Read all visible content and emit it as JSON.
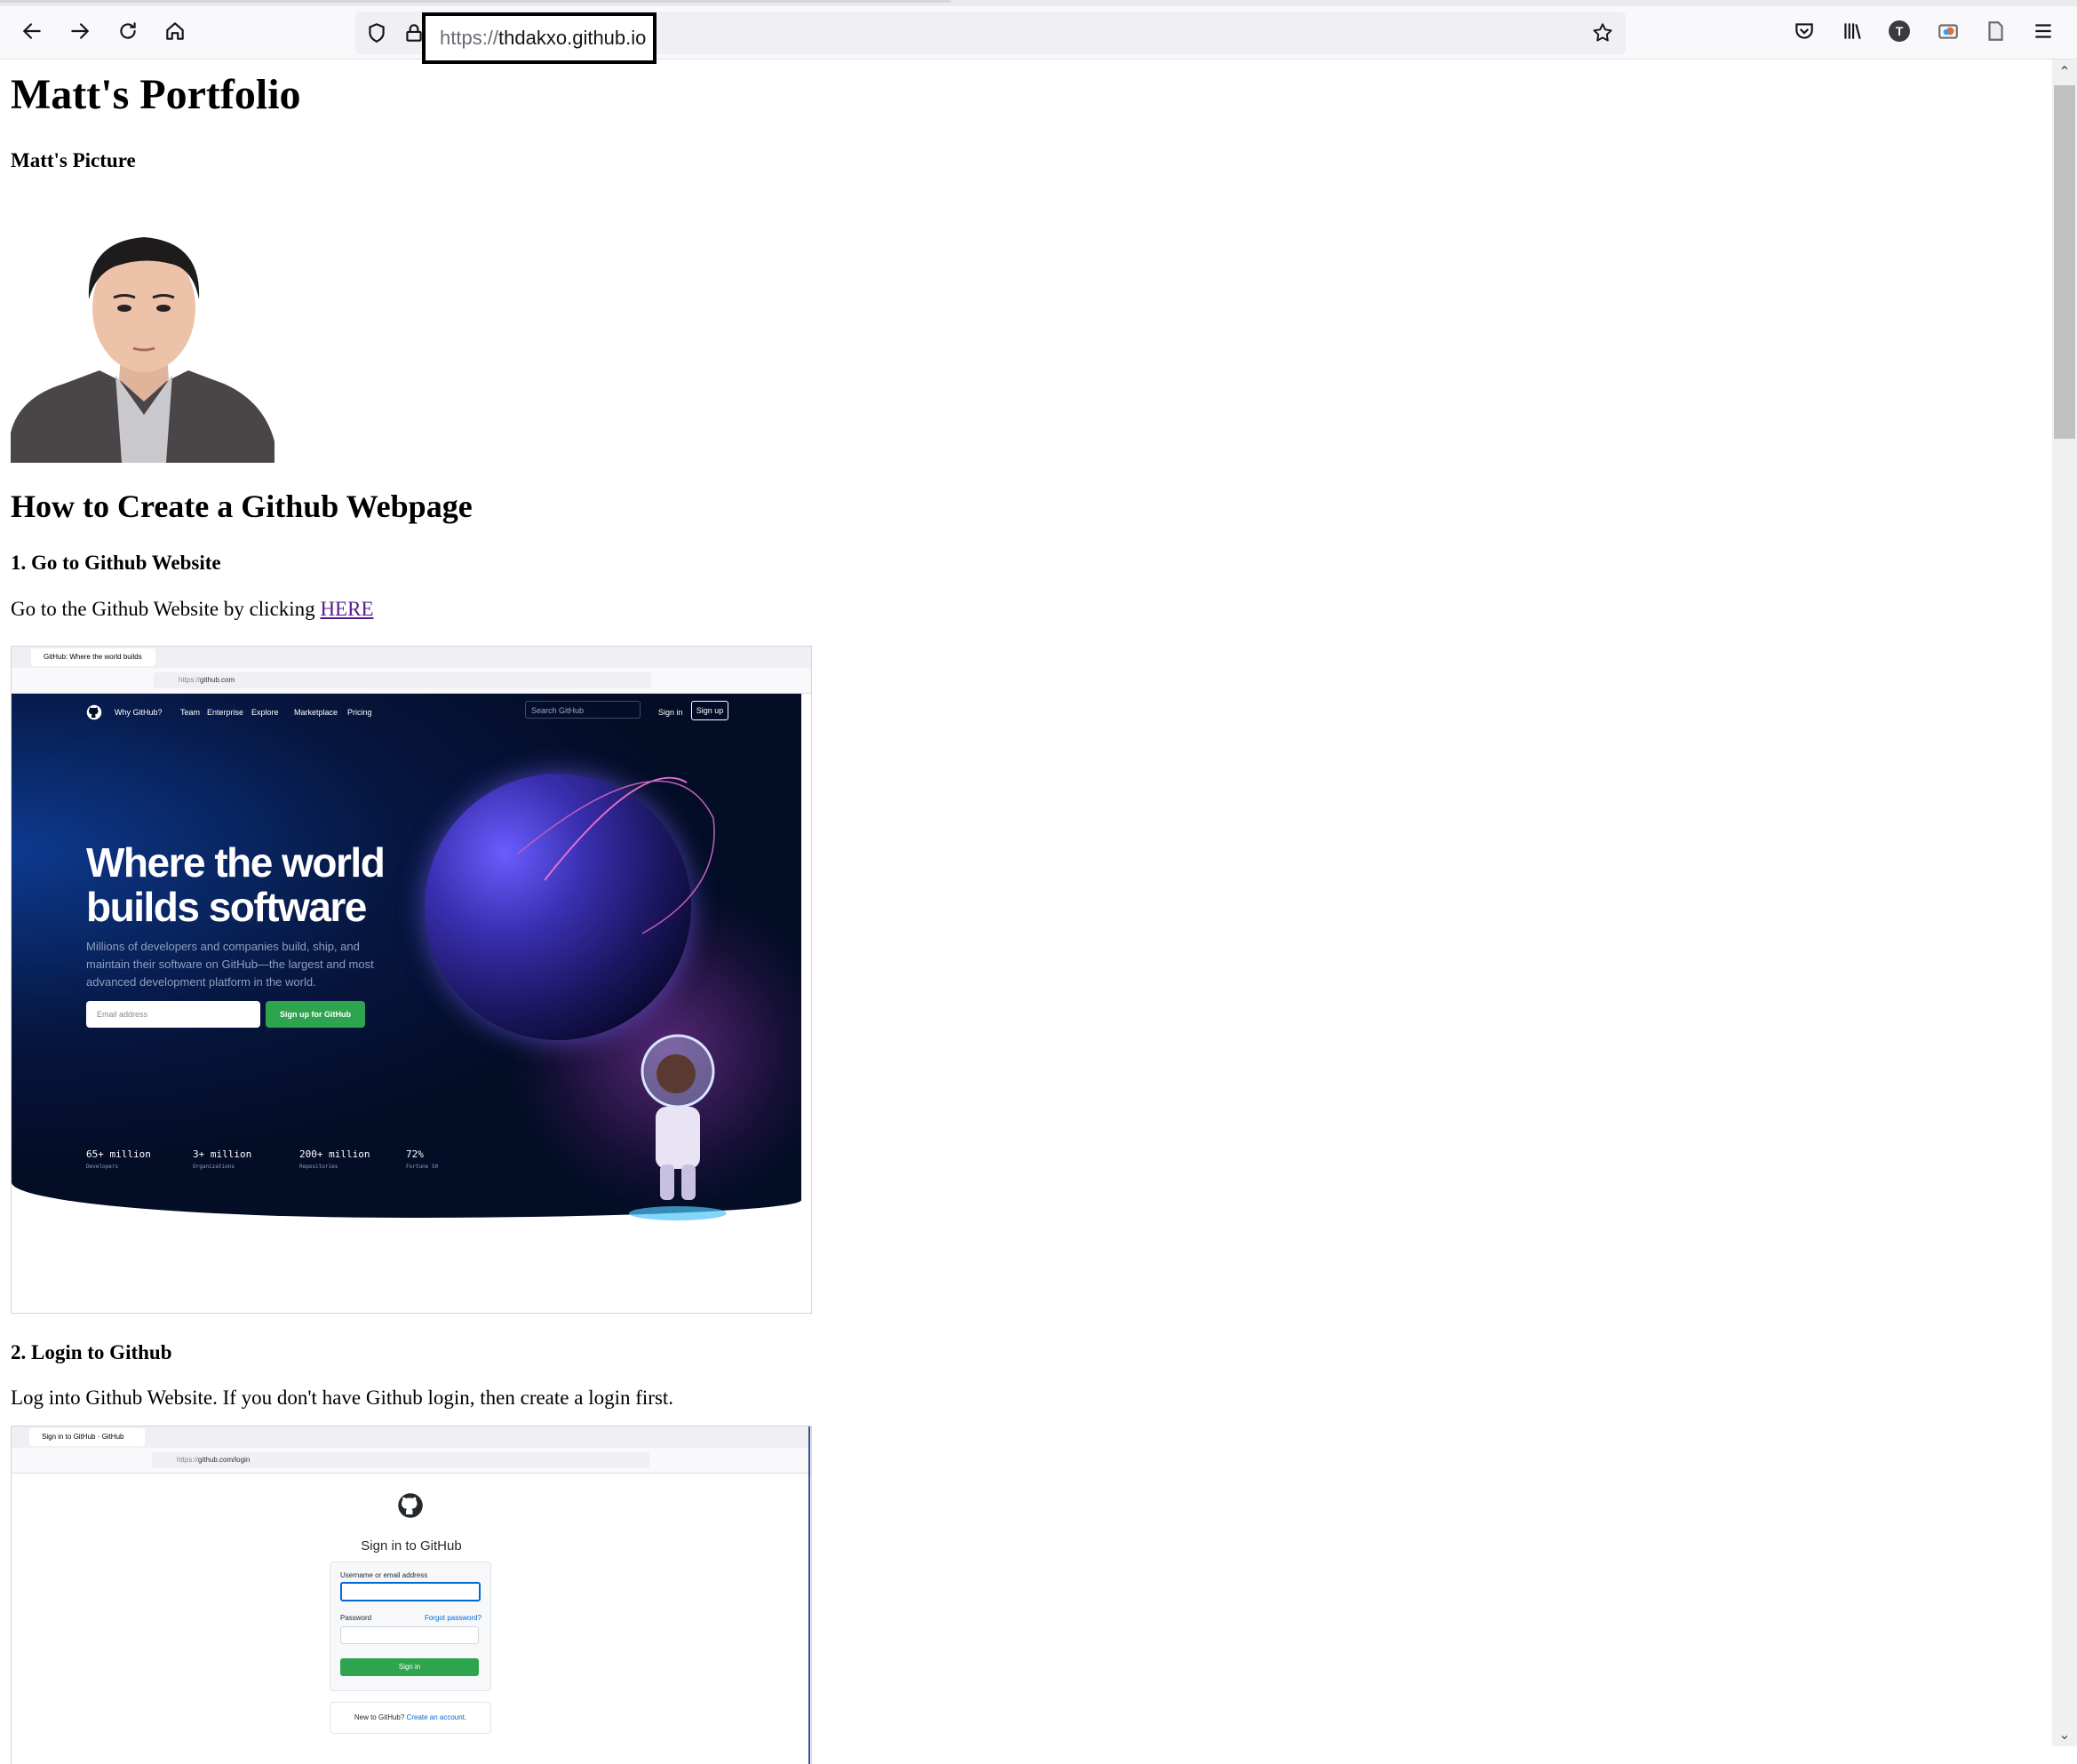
{
  "browser": {
    "url_scheme": "https://",
    "url_host": "thdakxo.github.io",
    "account_initial": "T"
  },
  "page": {
    "title": "Matt's Portfolio",
    "picture_heading": "Matt's Picture",
    "guide_heading": "How to Create a Github Webpage",
    "step1": {
      "heading": "1. Go to Github Website",
      "text": "Go to the Github Website by clicking ",
      "link": "HERE"
    },
    "step2": {
      "heading": "2. Login to Github",
      "text": "Log into Github Website. If you don't have Github login, then create a login first."
    }
  },
  "screenshot1": {
    "tab_title": "GitHub: Where the world builds",
    "url_scheme": "https://",
    "url_host": "github.com",
    "nav": {
      "why": "Why GitHub?",
      "team": "Team",
      "enterprise": "Enterprise",
      "explore": "Explore",
      "marketplace": "Marketplace",
      "pricing": "Pricing",
      "search": "Search GitHub",
      "signin": "Sign in",
      "signup": "Sign up"
    },
    "headline1": "Where the world",
    "headline2": "builds software",
    "subtext": "Millions of developers and companies build, ship, and maintain their software on GitHub—the largest and most advanced development platform in the world.",
    "email_placeholder": "Email address",
    "signup_button": "Sign up for GitHub",
    "stats": [
      {
        "value": "65+ million",
        "label": "Developers"
      },
      {
        "value": "3+ million",
        "label": "Organizations"
      },
      {
        "value": "200+ million",
        "label": "Repositories"
      },
      {
        "value": "72%",
        "label": "Fortune 50"
      }
    ]
  },
  "screenshot2": {
    "tab_title": "Sign in to GitHub · GitHub",
    "url_scheme": "https://",
    "url_host": "github.com/login",
    "title": "Sign in to GitHub",
    "username_label": "Username or email address",
    "password_label": "Password",
    "forgot": "Forgot password?",
    "signin_button": "Sign in",
    "new_text": "New to GitHub? ",
    "create_link": "Create an account."
  },
  "colors": {
    "link_visited": "#551a8b",
    "github_green": "#2ea44f",
    "github_navy": "#040d26"
  }
}
